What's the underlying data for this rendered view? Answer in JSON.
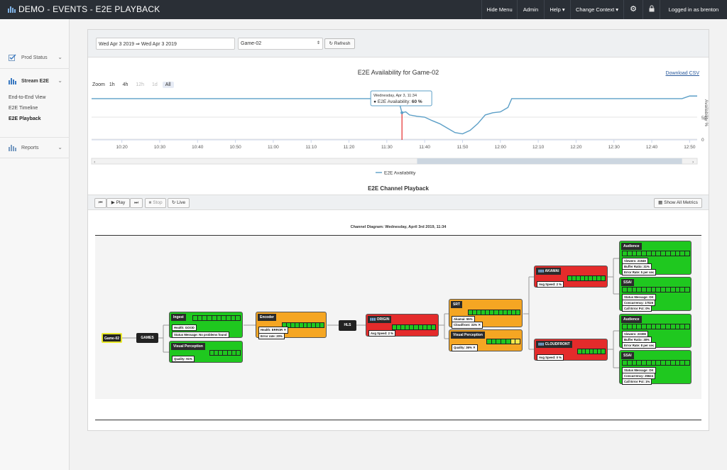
{
  "app": {
    "title": "DEMO - EVENTS - E2E PLAYBACK"
  },
  "nav": {
    "hide_menu": "Hide Menu",
    "admin": "Admin",
    "help": "Help",
    "change_context": "Change Context",
    "logged_in": "Logged in as brenton"
  },
  "sidebar": {
    "prod_status": "Prod Status",
    "stream_e2e": "Stream E2E",
    "items": [
      "End-to-End View",
      "E2E Timeline",
      "E2E Playback"
    ],
    "reports": "Reports"
  },
  "filters": {
    "date_range": "Wed Apr 3 2019  ⇒  Wed Apr 3 2019",
    "game": "Game-02",
    "refresh": "Refresh"
  },
  "chart": {
    "title": "E2E Availability for Game-02",
    "download": "Download CSV",
    "zoom_label": "Zoom",
    "zoom_options": [
      "1h",
      "4h",
      "12h",
      "1d",
      "All"
    ],
    "tooltip_date": "Wednesday, Apr 3, 11:34",
    "tooltip_label": "E2E Availability:",
    "tooltip_value": "60 %",
    "legend": "E2E Availability",
    "y_axis_label": "Availability %"
  },
  "chart_data": {
    "type": "line",
    "title": "E2E Availability for Game-02",
    "ylabel": "Availability %",
    "ylim": [
      0,
      100
    ],
    "yticks": [
      0,
      50
    ],
    "x_ticks": [
      "10:20",
      "10:30",
      "10:40",
      "10:50",
      "11:00",
      "11:10",
      "11:20",
      "11:30",
      "11:40",
      "11:50",
      "12:00",
      "12:10",
      "12:20",
      "12:30",
      "12:40",
      "12:50"
    ],
    "series": [
      {
        "name": "E2E Availability",
        "x": [
          "10:12",
          "10:20",
          "10:30",
          "10:40",
          "10:50",
          "11:00",
          "11:10",
          "11:20",
          "11:30",
          "11:33",
          "11:34",
          "11:35",
          "11:36",
          "11:38",
          "11:40",
          "11:42",
          "11:44",
          "11:46",
          "11:48",
          "11:50",
          "11:52",
          "11:54",
          "11:56",
          "11:58",
          "12:00",
          "12:02",
          "12:03",
          "12:10",
          "12:20",
          "12:30",
          "12:40",
          "12:48",
          "12:50",
          "12:52"
        ],
        "y": [
          92,
          92,
          92,
          92,
          92,
          92,
          92,
          92,
          92,
          92,
          60,
          62,
          55,
          52,
          50,
          42,
          35,
          25,
          15,
          12,
          20,
          35,
          55,
          60,
          62,
          72,
          92,
          92,
          92,
          92,
          92,
          92,
          98,
          98
        ]
      }
    ],
    "marker_x": "11:34"
  },
  "playback": {
    "header": "E2E Channel Playback",
    "controls": {
      "prev": "",
      "play": "Play",
      "next": "",
      "stop": "Stop",
      "live": "Live"
    },
    "show_all": "Show All Metrics",
    "diagram_title": "Channel Diagram: Wednesday, April 3rd 2019, 11:34"
  },
  "nodes": {
    "game": "Game-02",
    "games": "GAMES",
    "hls": "HLS",
    "ingest": {
      "title": "Ingest",
      "chips": [
        "Health: GOOD",
        "Status Message: No problems found"
      ]
    },
    "vp1": {
      "title": "Visual Perception",
      "chips": [
        "Quality: 91%"
      ]
    },
    "encoder": {
      "title": "Encoder",
      "chips": [
        "Health: ERROR ✕",
        "Error rate: 20%"
      ]
    },
    "origin": {
      "title": "ORIGIN",
      "chips": [
        "Avg Speed: 2 %"
      ]
    },
    "srt": {
      "title": "SRT",
      "chips": [
        "Akamai: 55%",
        "Cloudfront: 31% ✕"
      ]
    },
    "vp2": {
      "title": "Visual Perception",
      "chips": [
        "Quality: 36% ✕"
      ]
    },
    "akamai": {
      "title": "AKAMAI",
      "chips": [
        "Avg Speed: 2 %"
      ]
    },
    "cloudfront": {
      "title": "CLOUDFRONT",
      "chips": [
        "Avg Speed: 0 %"
      ]
    },
    "aud1": {
      "title": "Audience",
      "chips": [
        "Viewers: 21949",
        "Buffer Ratio: 31%",
        "Error Rate: 5 per sec"
      ]
    },
    "ssai1": {
      "title": "SSAI",
      "chips": [
        "Status Message: OK",
        "Concurrency: 17026",
        "Call Error Pct: 0%"
      ]
    },
    "aud2": {
      "title": "Audience",
      "chips": [
        "Viewers: 23308",
        "Buffer Ratio: 38%",
        "Error Rate: 8 per sec"
      ]
    },
    "ssai2": {
      "title": "SSAI",
      "chips": [
        "Status Message: OK",
        "Concurrency: 25624",
        "Call Error Pct: 1%"
      ]
    }
  },
  "colors": {
    "topbar": "#2a2f36",
    "ok": "#1fc81f",
    "warn": "#f5a623",
    "error": "#e42b2b",
    "line": "#5c9fc7",
    "marker": "#e00000"
  }
}
